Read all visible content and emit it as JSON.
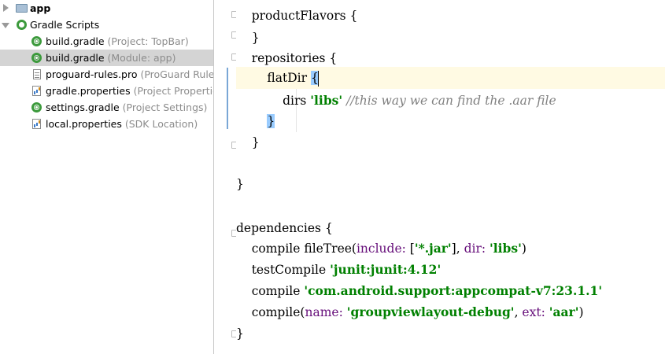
{
  "tree": {
    "items": [
      {
        "label": "app",
        "hint": "",
        "icon": "folder-icon",
        "arrow": "right",
        "bold": true
      },
      {
        "label": "Gradle Scripts",
        "hint": "",
        "icon": "gradle-scripts-icon",
        "arrow": "down",
        "bold": false
      },
      {
        "label": "build.gradle",
        "hint": " (Project: TopBar)",
        "icon": "gradle-file-icon",
        "arrow": "",
        "bold": false
      },
      {
        "label": "build.gradle",
        "hint": " (Module: app)",
        "icon": "gradle-file-icon",
        "arrow": "",
        "bold": false,
        "selected": true
      },
      {
        "label": "proguard-rules.pro",
        "hint": " (ProGuard Rules",
        "icon": "text-file-icon",
        "arrow": "",
        "bold": false
      },
      {
        "label": "gradle.properties",
        "hint": " (Project Properties",
        "icon": "properties-file-icon",
        "arrow": "",
        "bold": false
      },
      {
        "label": "settings.gradle",
        "hint": " (Project Settings)",
        "icon": "gradle-file-icon",
        "arrow": "",
        "bold": false
      },
      {
        "label": "local.properties",
        "hint": " (SDK Location)",
        "icon": "properties-file-icon",
        "arrow": "",
        "bold": false
      }
    ]
  },
  "code": {
    "l1": {
      "a": "    productFlavors {"
    },
    "l2": {
      "a": "    }"
    },
    "l3": {
      "a": "    repositories {"
    },
    "l4": {
      "a": "        flatDir ",
      "b": "{"
    },
    "l5": {
      "a": "            dirs ",
      "s": "'libs'",
      "c": " //this way we can find the .aar file"
    },
    "l6": {
      "a": "        ",
      "b": "}"
    },
    "l7": {
      "a": "    }"
    },
    "l8": {
      "a": ""
    },
    "l9": {
      "a": "}"
    },
    "l10": {
      "a": ""
    },
    "l11": {
      "a": "dependencies {"
    },
    "l12": {
      "a": "    compile fileTree(",
      "n1": "include: ",
      "a2": "[",
      "s1": "'*.jar'",
      "a3": "], ",
      "n2": "dir: ",
      "s2": "'libs'",
      "a4": ")"
    },
    "l13": {
      "a": "    testCompile ",
      "s": "'junit:junit:4.12'"
    },
    "l14": {
      "a": "    compile ",
      "s": "'com.android.support:appcompat-v7:23.1.1'"
    },
    "l15": {
      "a": "    compile(",
      "n1": "name: ",
      "s1": "'groupviewlayout-debug'",
      "a2": ", ",
      "n2": "ext: ",
      "s2": "'aar'",
      "a3": ")"
    },
    "l16": {
      "a": "}"
    }
  },
  "colors": {
    "string": "#008000",
    "named_arg": "#660e7a",
    "comment": "#808080",
    "brace_highlight": "#99ccff",
    "caret_row": "#fffae3",
    "selected_row": "#d4d4d4"
  }
}
